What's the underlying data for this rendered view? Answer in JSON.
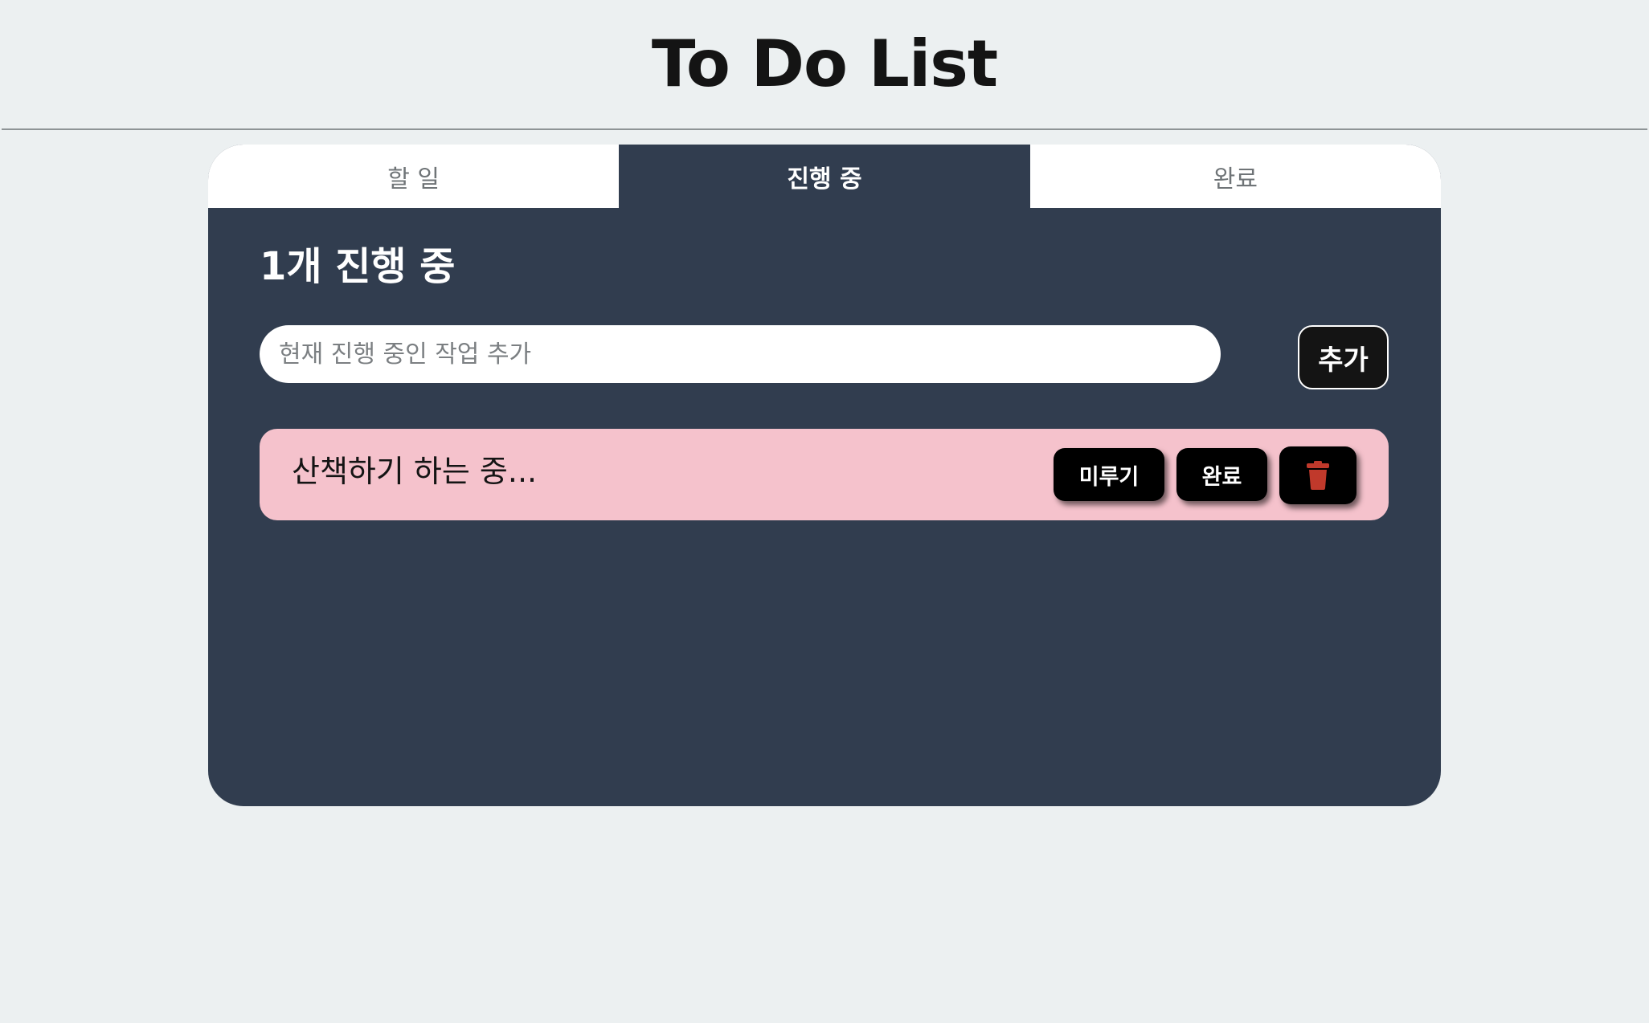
{
  "header": {
    "title": "To Do List"
  },
  "tabs": [
    {
      "label": "할 일",
      "active": false
    },
    {
      "label": "진행 중",
      "active": true
    },
    {
      "label": "완료",
      "active": false
    }
  ],
  "main": {
    "count_title": "1개 진행 중",
    "input": {
      "value": "",
      "placeholder": "현재 진행 중인 작업 추가"
    },
    "add_label": "추가",
    "tasks": [
      {
        "text": "산책하기 하는 중...",
        "postpone_label": "미루기",
        "complete_label": "완료",
        "delete_icon": "trash-icon"
      }
    ]
  },
  "colors": {
    "background": "#ecf0f1",
    "card": "#313d4f",
    "task_row": "#f5c2cc",
    "button": "#000000",
    "trash_icon": "#c0392b"
  }
}
